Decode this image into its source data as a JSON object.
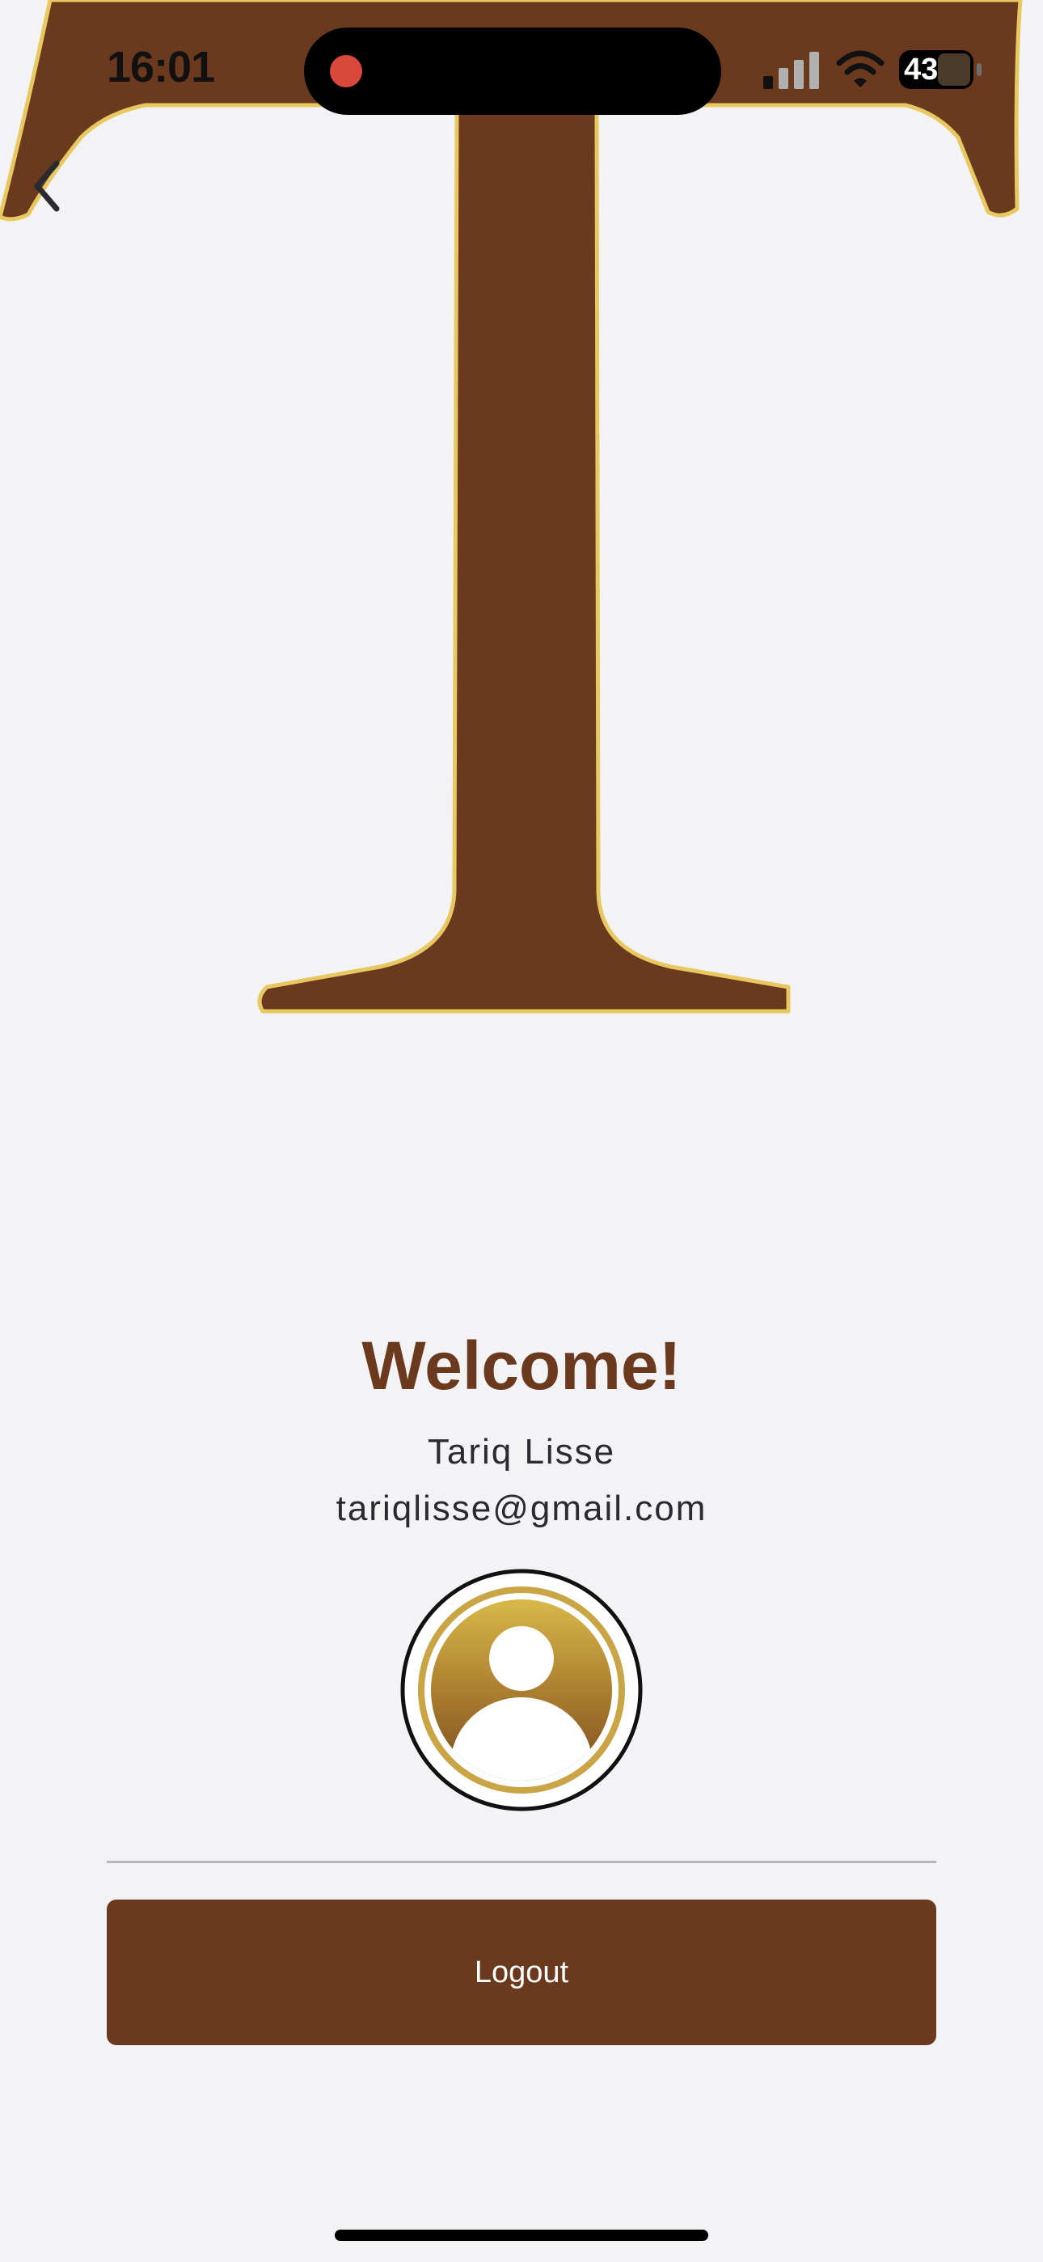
{
  "status_bar": {
    "time": "16:01",
    "battery": "43",
    "signal_icon": "cellular-signal-icon",
    "wifi_icon": "wifi-icon",
    "recording_color": "#d9483b"
  },
  "nav": {
    "back_icon": "chevron-left-icon"
  },
  "brand": {
    "logo_icon": "letter-t-logo",
    "logo_color": "#6b3a1e",
    "logo_outline_color": "#e8c860"
  },
  "profile": {
    "welcome": "Welcome!",
    "name": "Tariq Lisse",
    "email": "tariqlisse@gmail.com",
    "avatar_icon": "user-avatar-icon"
  },
  "actions": {
    "logout_label": "Logout",
    "accent_color": "#6b3a1e"
  }
}
